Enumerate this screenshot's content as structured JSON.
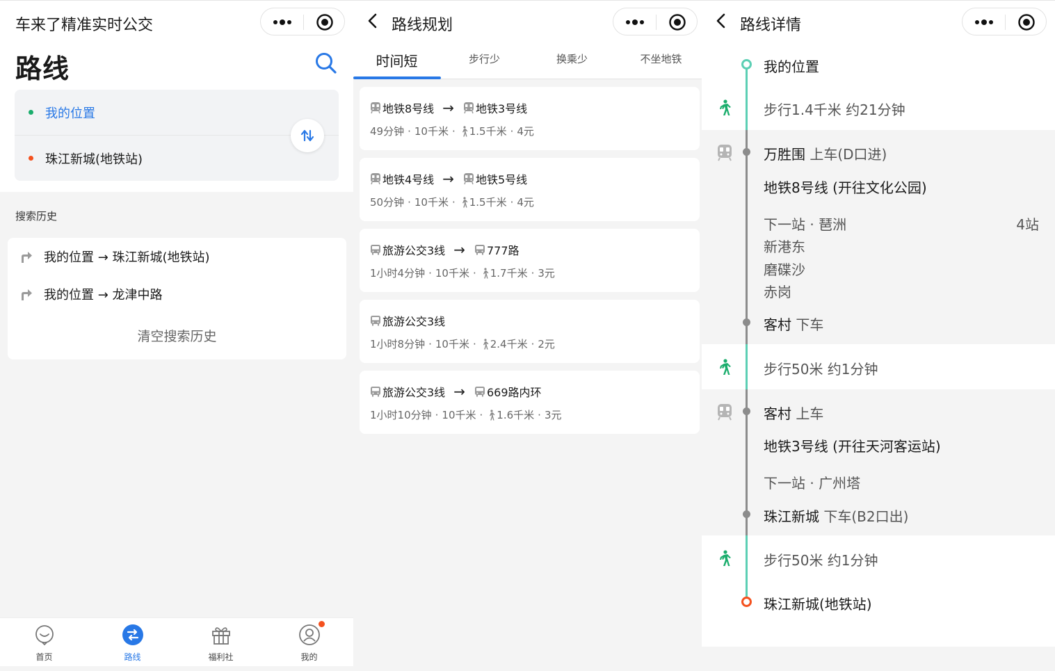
{
  "colors": {
    "blue": "#2878e6",
    "green": "#1aad6c",
    "orange": "#f4511e",
    "teal_line": "#5ccfb4",
    "gray_line": "#8c8c8c"
  },
  "panel1": {
    "app_title": "车来了精准实时公交",
    "page_title": "路线",
    "origin": "我的位置",
    "destination": "珠江新城(地铁站)",
    "history_label": "搜索历史",
    "history": [
      "我的位置 → 珠江新城(地铁站)",
      "我的位置 → 龙津中路"
    ],
    "clear_history": "清空搜索历史",
    "tabs": [
      {
        "label": "首页",
        "icon": "home-icon"
      },
      {
        "label": "路线",
        "icon": "route-icon",
        "active": true
      },
      {
        "label": "福利社",
        "icon": "gift-icon"
      },
      {
        "label": "我的",
        "icon": "profile-icon",
        "badge": true
      }
    ]
  },
  "panel2": {
    "title": "路线规划",
    "tabs": [
      "时间短",
      "步行少",
      "换乘少",
      "不坐地铁"
    ],
    "active_tab": 0,
    "routes": [
      {
        "legs": [
          {
            "type": "subway",
            "name": "地铁8号线"
          },
          {
            "type": "subway",
            "name": "地铁3号线"
          }
        ],
        "time": "49分钟",
        "distance": "10千米",
        "walk": "1.5千米",
        "price": "4元"
      },
      {
        "legs": [
          {
            "type": "subway",
            "name": "地铁4号线"
          },
          {
            "type": "subway",
            "name": "地铁5号线"
          }
        ],
        "time": "50分钟",
        "distance": "10千米",
        "walk": "1.5千米",
        "price": "4元"
      },
      {
        "legs": [
          {
            "type": "bus",
            "name": "旅游公交3线"
          },
          {
            "type": "bus",
            "name": "777路"
          }
        ],
        "time": "1小时4分钟",
        "distance": "10千米",
        "walk": "1.7千米",
        "price": "3元"
      },
      {
        "legs": [
          {
            "type": "bus",
            "name": "旅游公交3线"
          }
        ],
        "time": "1小时8分钟",
        "distance": "10千米",
        "walk": "2.4千米",
        "price": "2元"
      },
      {
        "legs": [
          {
            "type": "bus",
            "name": "旅游公交3线"
          },
          {
            "type": "bus",
            "name": "669路内环"
          }
        ],
        "time": "1小时10分钟",
        "distance": "10千米",
        "walk": "1.6千米",
        "price": "3元"
      }
    ]
  },
  "panel3": {
    "title": "路线详情",
    "start": "我的位置",
    "walk1": "步行1.4千米 约21分钟",
    "seg1": {
      "board_stop": "万胜围",
      "board_action": "上车(D口进)",
      "line": "地铁8号线 (开往文化公园)",
      "next_stop": "下一站 · 琶洲",
      "stop_count": "4站",
      "stops": [
        "新港东",
        "磨碟沙",
        "赤岗"
      ],
      "alight_stop": "客村",
      "alight_action": "下车"
    },
    "walk2": "步行50米 约1分钟",
    "seg2": {
      "board_stop": "客村",
      "board_action": "上车",
      "line": "地铁3号线 (开往天河客运站)",
      "next_stop": "下一站 · 广州塔",
      "alight_stop": "珠江新城",
      "alight_action": "下车(B2口出)"
    },
    "walk3": "步行50米 约1分钟",
    "end": "珠江新城(地铁站)"
  }
}
